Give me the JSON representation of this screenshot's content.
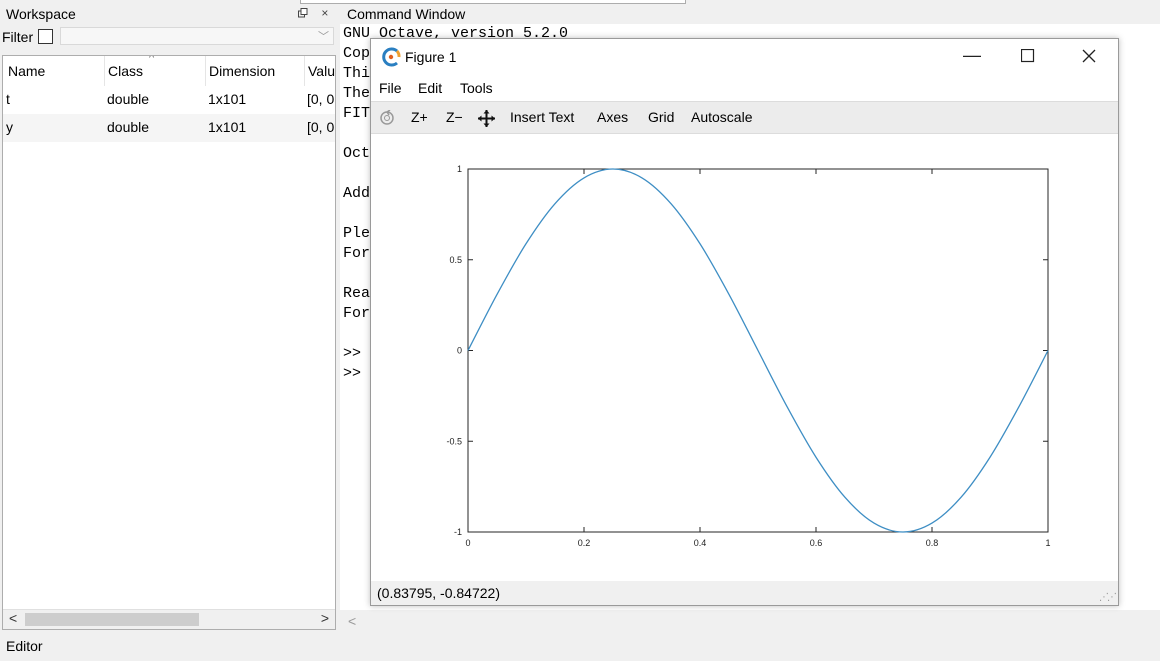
{
  "workspace": {
    "title": "Workspace",
    "undock_icon": "undock-icon",
    "close_symbol": "×",
    "filter_label": "Filter",
    "filter_value": "",
    "columns": [
      "Name",
      "Class",
      "Dimension",
      "Valu"
    ],
    "rows": [
      {
        "name": "t",
        "class": "double",
        "dimension": "1x101",
        "value": "[0, 0"
      },
      {
        "name": "y",
        "class": "double",
        "dimension": "1x101",
        "value": "[0, 0"
      }
    ]
  },
  "editor_tab": "Editor",
  "command_window": {
    "title": "Command Window",
    "lines": [
      "GNU Octave, version 5.2.0",
      "Cop",
      "Thi",
      "The",
      "FIT",
      "",
      "Oct",
      "",
      "Add",
      "",
      "Ple",
      "For",
      "",
      "Rea",
      "For",
      "",
      ">>",
      ">>"
    ]
  },
  "figure": {
    "title": "Figure 1",
    "menu": [
      "File",
      "Edit",
      "Tools"
    ],
    "toolbar": {
      "zoom_in": "Z+",
      "zoom_out": "Z−",
      "insert_text": "Insert Text",
      "axes": "Axes",
      "grid": "Grid",
      "autoscale": "Autoscale"
    },
    "status_coords": "(0.83795, -0.84722)"
  },
  "chart_data": {
    "type": "line",
    "title": "",
    "xlabel": "",
    "ylabel": "",
    "xlim": [
      0,
      1
    ],
    "ylim": [
      -1,
      1
    ],
    "xticks": [
      "0",
      "0.2",
      "0.4",
      "0.6",
      "0.8",
      "1"
    ],
    "yticks": [
      "-1",
      "-0.5",
      "0",
      "0.5",
      "1"
    ],
    "grid": false,
    "series": [
      {
        "color": "#3e8ec4",
        "x": [
          0,
          0.05,
          0.1,
          0.15,
          0.2,
          0.25,
          0.3,
          0.35,
          0.4,
          0.45,
          0.5,
          0.55,
          0.6,
          0.65,
          0.7,
          0.75,
          0.8,
          0.85,
          0.9,
          0.95,
          1
        ],
        "y": [
          0,
          0.309,
          0.588,
          0.809,
          0.951,
          1,
          0.951,
          0.809,
          0.588,
          0.309,
          0,
          -0.309,
          -0.588,
          -0.809,
          -0.951,
          -1,
          -0.951,
          -0.809,
          -0.588,
          -0.309,
          0
        ]
      }
    ]
  }
}
